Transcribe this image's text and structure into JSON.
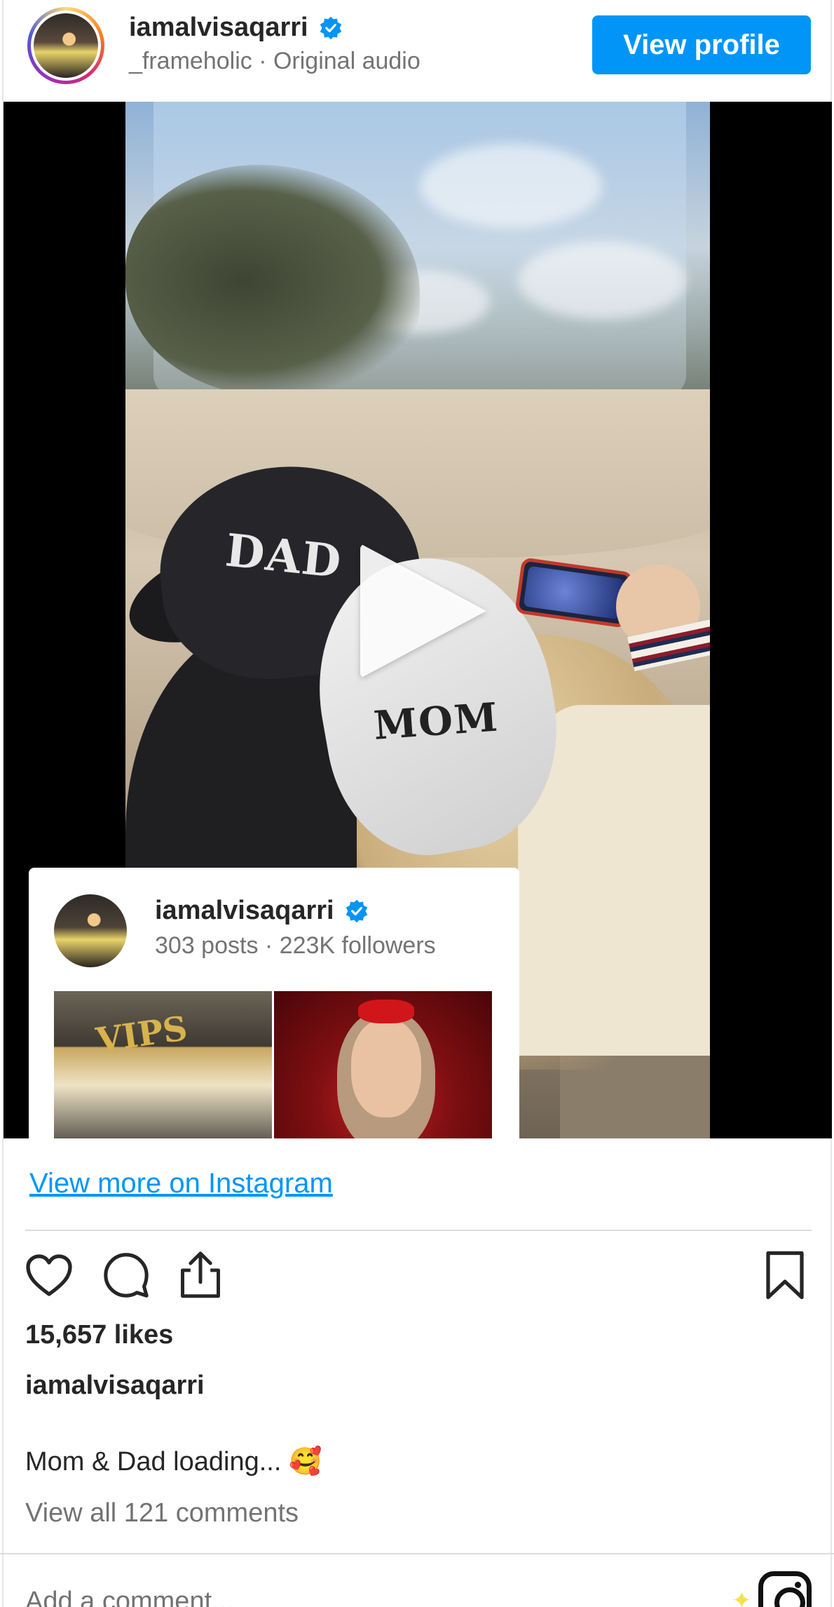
{
  "header": {
    "username": "iamalvisaqarri",
    "subline": "_frameholic · Original audio",
    "view_profile_label": "View profile"
  },
  "media": {
    "cap_left_text": "DAD",
    "cap_right_text": "MOM"
  },
  "profile_card": {
    "username": "iamalvisaqarri",
    "stats": "303 posts · 223K followers",
    "thumb1_sign": "VIPS"
  },
  "footer": {
    "view_more_label": "View more on Instagram",
    "likes": "15,657 likes",
    "caption_user": "iamalvisaqarri",
    "caption": "Mom & Dad loading... 🥰",
    "comments_link": "View all 121 comments",
    "add_comment_placeholder": "Add a comment..."
  },
  "icons": {
    "verified": "verified-badge-icon",
    "like": "heart-icon",
    "comment": "comment-icon",
    "share": "share-icon",
    "save": "bookmark-icon",
    "instagram": "instagram-logo-icon",
    "play": "play-icon"
  },
  "colors": {
    "accent": "#0095f6",
    "verified": "#0095f6",
    "text": "#262626",
    "muted": "#737373"
  }
}
